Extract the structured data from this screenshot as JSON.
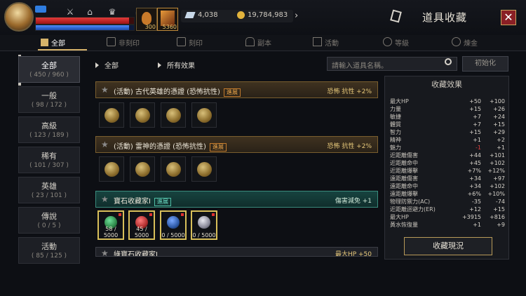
{
  "header": {
    "title": "道具收藏",
    "currency_crystal": "4,038",
    "currency_gold": "19,784,983",
    "slot1_count": "300",
    "slot2_count": "5360",
    "hp_fraction": 0.95,
    "mp_fraction": 0.95
  },
  "tabs": [
    "全部",
    "非刻印",
    "刻印",
    "副本",
    "活動",
    "等級",
    "煉金"
  ],
  "categories": [
    {
      "name": "全部",
      "count": "( 450 / 960 )"
    },
    {
      "name": "一般",
      "count": "( 98 / 172 )"
    },
    {
      "name": "高級",
      "count": "( 123 / 189 )"
    },
    {
      "name": "稀有",
      "count": "( 101 / 307 )"
    },
    {
      "name": "英雄",
      "count": "( 23 / 101 )"
    },
    {
      "name": "傳說",
      "count": "( 0 / 5 )"
    },
    {
      "name": "活動",
      "count": "( 85 / 125 )"
    }
  ],
  "filters": {
    "category": "全部",
    "effect": "所有效果"
  },
  "search": {
    "placeholder": "請輸入道具名稱。",
    "reset": "初始化"
  },
  "collections": [
    {
      "name": "(活動) 古代英雄的憑證 (恐怖抗性)",
      "badge": "進展",
      "effect": "恐怖 抗性 +2%"
    },
    {
      "name": "(活動) 雷神的憑證 (恐怖抗性)",
      "badge": "進展",
      "effect": "恐怖 抗性 +2%"
    },
    {
      "name": "寶石收藏家I",
      "badge": "進展",
      "effect": "傷害減免 +1"
    },
    {
      "name": "綠寶石收藏家I",
      "effect": "最大HP +50"
    }
  ],
  "gems": [
    {
      "count": "58 / 5000",
      "color": "#2f8a4a"
    },
    {
      "count": "45 / 5000",
      "color": "#b02e2e"
    },
    {
      "count": "0 / 5000",
      "color": "#2e5aa8"
    },
    {
      "count": "0 / 5000",
      "color": "#8a8a9a"
    }
  ],
  "effects_panel": {
    "title": "收藏效果",
    "button": "收藏現況",
    "stats": [
      {
        "label": "最大HP",
        "v1": "+50",
        "v2": "+100"
      },
      {
        "label": "力量",
        "v1": "+15",
        "v2": "+26"
      },
      {
        "label": "敏捷",
        "v1": "+7",
        "v2": "+24"
      },
      {
        "label": "體質",
        "v1": "+7",
        "v2": "+15"
      },
      {
        "label": "智力",
        "v1": "+15",
        "v2": "+29"
      },
      {
        "label": "精神",
        "v1": "+1",
        "v2": "+2"
      },
      {
        "label": "魅力",
        "v1": "-1",
        "v2": "+1"
      },
      {
        "label": "近距離傷害",
        "v1": "+44",
        "v2": "+101"
      },
      {
        "label": "近距離命中",
        "v1": "+45",
        "v2": "+102"
      },
      {
        "label": "近距離爆擊",
        "v1": "+7%",
        "v2": "+12%"
      },
      {
        "label": "遠距離傷害",
        "v1": "+34",
        "v2": "+97"
      },
      {
        "label": "遠距離命中",
        "v1": "+34",
        "v2": "+102"
      },
      {
        "label": "遠距離爆擊",
        "v1": "+6%",
        "v2": "+10%"
      },
      {
        "label": "物理防禦力(AC)",
        "v1": "-35",
        "v2": "-74"
      },
      {
        "label": "近距離迴避力(ER)",
        "v1": "+12",
        "v2": "+15"
      },
      {
        "label": "最大HP",
        "v1": "+3915",
        "v2": "+816"
      },
      {
        "label": "黃水恢復量",
        "v1": "+1",
        "v2": "+9"
      }
    ]
  }
}
